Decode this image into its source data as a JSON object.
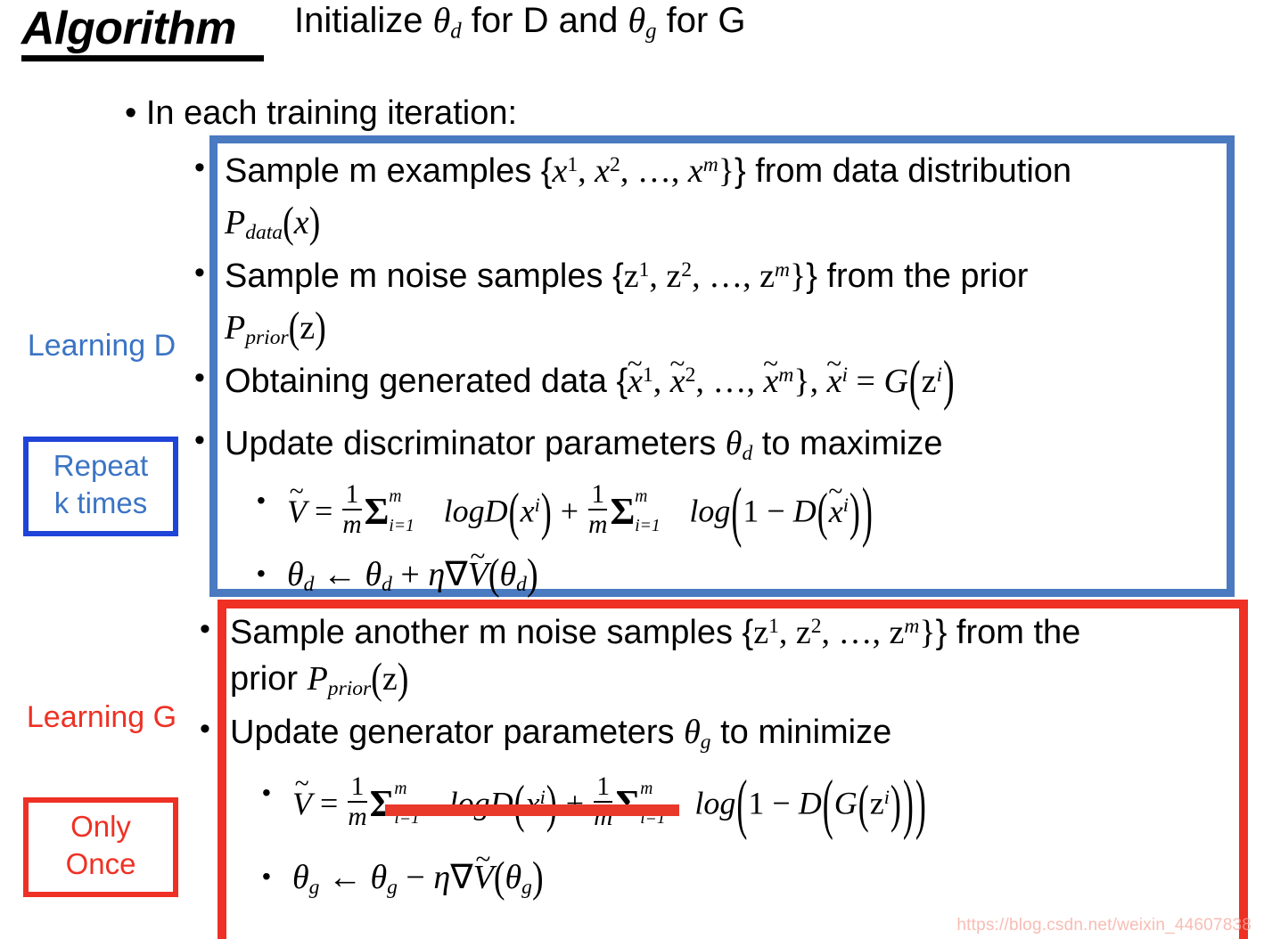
{
  "slide": {
    "title": "Algorithm",
    "init_line": {
      "pre": "Initialize ",
      "theta_d": "θ",
      "sub_d": "d",
      "mid": " for D and ",
      "theta_g": "θ",
      "sub_g": "g",
      "post": " for G"
    },
    "iteration_header": "In each training iteration:",
    "bullet_glyph": "•"
  },
  "side_labels": {
    "learning_d": "Learning D",
    "repeat_k_times": "Repeat\nk times",
    "repeat_k_line1": "Repeat",
    "repeat_k_line2": "k times",
    "learning_g": "Learning G",
    "only_once_line1": "Only",
    "only_once_line2": "Once"
  },
  "learning_d_steps": [
    {
      "id": "sample-m-examples",
      "line1_pre": "Sample m examples {",
      "line1_set": "x¹, x², … , xᵐ",
      "line1_post": "} from data distribution",
      "line2": "P_data(x)"
    },
    {
      "id": "sample-m-noise",
      "line1_pre": "Sample m noise samples {",
      "line1_set": "z¹, z², … , zᵐ",
      "line1_post": "} from the prior",
      "line2": "P_prior(z)"
    },
    {
      "id": "obtaining-generated-data",
      "line1_pre": "Obtaining generated data {",
      "line1_set": "x̃¹, x̃², … , x̃ᵐ",
      "line1_post": "}, x̃ⁱ = G(zⁱ)"
    },
    {
      "id": "update-discriminator",
      "line1_pre": "Update discriminator parameters ",
      "line1_sym": "θ_d",
      "line1_post": " to maximize"
    }
  ],
  "learning_d_equations": [
    {
      "id": "v-tilde-discriminator",
      "latex": "Ṽ = (1/m)Σ_{i=1}^{m} logD(xⁱ) + (1/m)Σ_{i=1}^{m} log(1 − D(x̃ⁱ))",
      "struck": false
    },
    {
      "id": "theta-d-update",
      "latex": "θ_d ← θ_d + η∇Ṽ(θ_d)",
      "struck": false
    }
  ],
  "learning_g_steps": [
    {
      "id": "sample-another-m-noise",
      "line1_pre": "Sample another m noise samples {",
      "line1_set": "z¹, z², … , zᵐ",
      "line1_post": "} from the",
      "line2_pre": "prior ",
      "line2_sym": "P_prior(z)"
    },
    {
      "id": "update-generator",
      "line1_pre": "Update generator parameters ",
      "line1_sym": "θ_g",
      "line1_post": " to minimize"
    }
  ],
  "learning_g_equations": [
    {
      "id": "v-tilde-generator",
      "latex": "Ṽ = (1/m)Σ_{i=1}^{m} logD(xⁱ) + (1/m)Σ_{i=1}^{m} log(1 − D(G(zⁱ)))",
      "struck": true,
      "struck_note": "first term crossed out in red"
    },
    {
      "id": "theta-g-update",
      "latex": "θ_g ← θ_g − η∇Ṽ(θ_g)",
      "struck": false
    }
  ],
  "symbols": {
    "theta": "θ",
    "eta": "η",
    "nabla": "∇",
    "sigma": "Σ",
    "left_arrow": "←",
    "tilde": "̃",
    "minus": "−",
    "plus": "+",
    "equals": "=",
    "ellipsis": "…",
    "lbrace": "{",
    "rbrace": "}"
  },
  "labels": {
    "sub_d": "d",
    "sub_g": "g",
    "sub_data": "data",
    "sub_prior": "prior",
    "sub_i1": "i=1",
    "sup_m": "m",
    "sup_i": "i",
    "sup_1": "1",
    "sup_2": "2",
    "var_x": "x",
    "var_z": "z",
    "var_m": "m",
    "var_P": "P",
    "var_D": "D",
    "var_G": "G",
    "var_V": "V",
    "num_1": "1",
    "log": "log",
    "logD": "logD"
  },
  "colors": {
    "blue_box": "#4A7AC0",
    "blue_text": "#3B74C4",
    "blue_inner_box": "#1F44D8",
    "red": "#EE3124",
    "strike_red": "#E8392A",
    "black": "#000000",
    "watermark": "#F6A79C"
  },
  "watermark": "https://blog.csdn.net/weixin_44607838"
}
